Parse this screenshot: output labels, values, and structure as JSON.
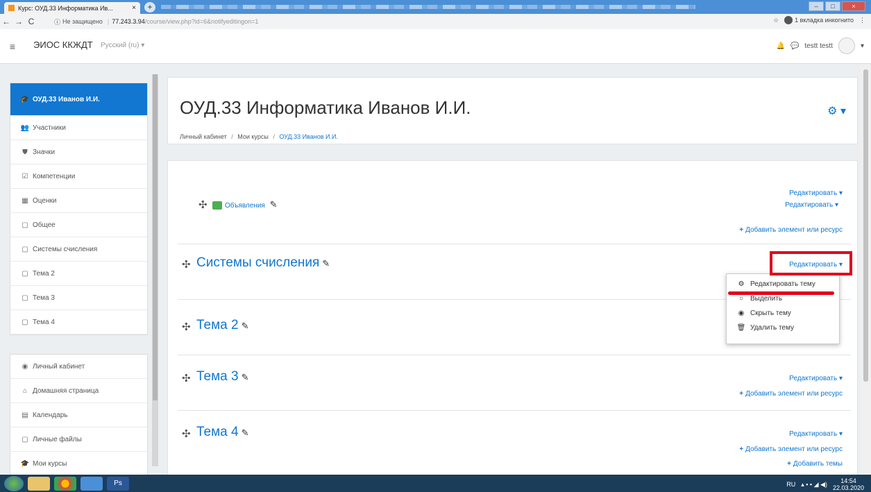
{
  "browser": {
    "tab_title": "Курс: ОУД.33 Информатика Ив...",
    "tab_close": "×",
    "new_tab": "+",
    "not_secure": "Не защищено",
    "url_host": "77.243.3.94",
    "url_path": "/course/view.php?id=6&notifyeditingon=1",
    "incognito_label": "1 вкладка инкогнито",
    "nav_back": "←",
    "nav_forward": "→",
    "nav_reload": "C",
    "star": "☆",
    "menu": "⋮"
  },
  "navbar": {
    "menu_icon": "≡",
    "brand": "ЭИОС ККЖДТ",
    "language": "Русский (ru) ▾",
    "user_name": "testt testt",
    "bell": "🔔",
    "chat": "💬",
    "caret": "▾"
  },
  "drawer": {
    "course_items": [
      {
        "icon": "🎓",
        "label": "ОУД.33 Иванов И.И."
      },
      {
        "icon": "👥",
        "label": "Участники"
      },
      {
        "icon": "⛊",
        "label": "Значки"
      },
      {
        "icon": "☑",
        "label": "Компетенции"
      },
      {
        "icon": "▦",
        "label": "Оценки"
      },
      {
        "icon": "▢",
        "label": "Общее"
      },
      {
        "icon": "▢",
        "label": "Системы счисления"
      },
      {
        "icon": "▢",
        "label": "Тема 2"
      },
      {
        "icon": "▢",
        "label": "Тема 3"
      },
      {
        "icon": "▢",
        "label": "Тема 4"
      }
    ],
    "site_items": [
      {
        "icon": "◉",
        "label": "Личный кабинет"
      },
      {
        "icon": "⌂",
        "label": "Домашняя страница"
      },
      {
        "icon": "▤",
        "label": "Календарь"
      },
      {
        "icon": "▢",
        "label": "Личные файлы"
      },
      {
        "icon": "🎓",
        "label": "Мои курсы"
      }
    ]
  },
  "header": {
    "title": "ОУД.33 Информатика Иванов И.И.",
    "breadcrumb": [
      "Личный кабинет",
      "Мои курсы",
      "ОУД.33 Иванов И.И."
    ],
    "gear": "⚙ ▾"
  },
  "sections": {
    "general": {
      "forum_label": "Объявления",
      "edit1": "Редактировать ▾",
      "edit2": "Редактировать ▾",
      "add": "Добавить элемент или ресурс"
    },
    "numeral": {
      "title": "Системы счисления",
      "edit": "Редактировать ▾"
    },
    "topic2": {
      "title": "Тема 2"
    },
    "topic3": {
      "title": "Тема 3",
      "edit": "Редактировать ▾",
      "add": "Добавить элемент или ресурс"
    },
    "topic4": {
      "title": "Тема 4",
      "edit": "Редактировать ▾",
      "add": "Добавить элемент или ресурс"
    },
    "add_topics": "Добавить темы"
  },
  "dropdown": {
    "items": [
      {
        "icon": "⚙",
        "label": "Редактировать тему"
      },
      {
        "icon": "○",
        "label": "Выделить"
      },
      {
        "icon": "◉",
        "label": "Скрыть тему"
      },
      {
        "icon": "🗑",
        "label": "Удалить тему"
      }
    ]
  },
  "icons": {
    "move": "✣",
    "pencil": "✎",
    "plus": "+"
  },
  "taskbar": {
    "lang": "RU",
    "time": "14:54",
    "date": "22.03.2020"
  },
  "colors": {
    "accent": "#1177d1",
    "highlight": "#e3001b"
  }
}
